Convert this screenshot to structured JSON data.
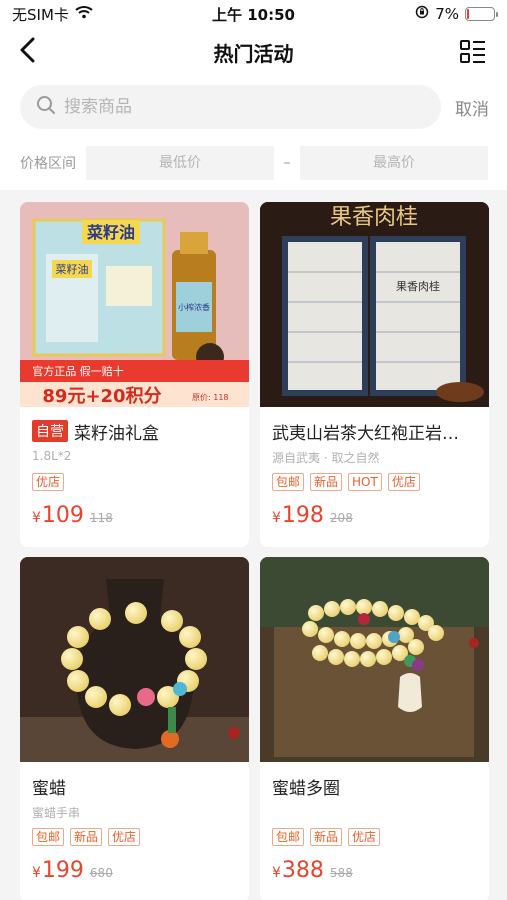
{
  "status": {
    "carrier": "无SIM卡",
    "time": "上午 10:50",
    "battery": "7%",
    "battery_level": 0.07
  },
  "nav": {
    "title": "热门活动"
  },
  "search": {
    "placeholder": "搜索商品",
    "cancel_label": "取消"
  },
  "price_filter": {
    "label": "价格区间",
    "min_placeholder": "最低价",
    "separator": "–",
    "max_placeholder": "最高价"
  },
  "products": [
    {
      "self_badge": "自营",
      "title": "菜籽油礼盒",
      "subtitle": "1.8L*2",
      "tags": [
        "优店"
      ],
      "price_symbol": "¥",
      "price": "109",
      "original_price": "118",
      "image": {
        "box_title": "菜籽油",
        "box_label": "菜籽油",
        "bottle_label": "小榨浓香",
        "banner_top": "官方正品  假一赔十",
        "banner_bottom": "89元+20积分",
        "banner_note": "原价: 118"
      }
    },
    {
      "self_badge": "",
      "title": "武夷山岩茶大红袍正岩…",
      "subtitle": "源自武夷 · 取之自然",
      "tags": [
        "包邮",
        "新品",
        "HOT",
        "优店"
      ],
      "price_symbol": "¥",
      "price": "198",
      "original_price": "208",
      "image": {
        "headline": "果香肉桂",
        "box_text": "果香肉桂"
      }
    },
    {
      "self_badge": "",
      "title": "蜜蜡",
      "subtitle": "蜜蜡手串",
      "tags": [
        "包邮",
        "新品",
        "优店"
      ],
      "price_symbol": "¥",
      "price": "199",
      "original_price": "680"
    },
    {
      "self_badge": "",
      "title": "蜜蜡多圈",
      "subtitle": "",
      "tags": [
        "包邮",
        "新品",
        "优店"
      ],
      "price_symbol": "¥",
      "price": "388",
      "original_price": "588"
    }
  ],
  "icons": {
    "back": "chevron-left-icon",
    "menu": "grid-list-icon",
    "search": "search-icon",
    "wifi": "wifi-icon",
    "lock": "orientation-lock-icon",
    "battery": "battery-icon"
  },
  "colors": {
    "accent": "#e8442e",
    "tag_border": "#f0a88a",
    "tag_text": "#e9602e",
    "self_badge": "#e33c2b",
    "background": "#f4f4f4"
  }
}
